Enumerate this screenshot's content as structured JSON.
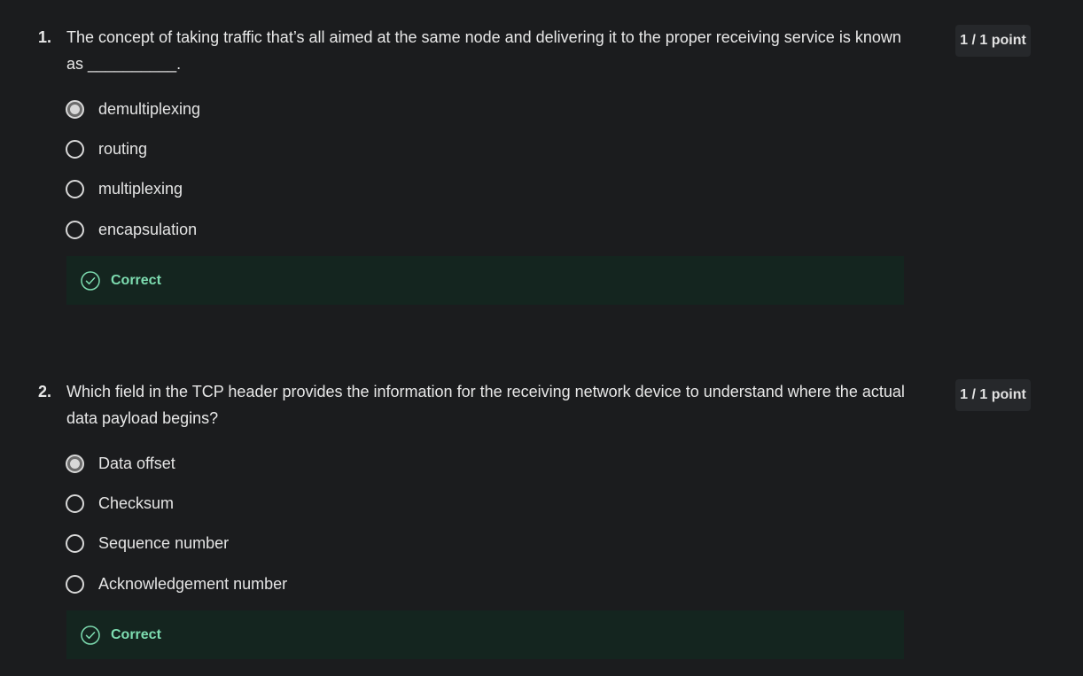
{
  "questions": [
    {
      "number": "1.",
      "text": "The concept of taking traffic that’s all aimed at the same node and delivering it to the proper receiving service is known as __________.",
      "points": "1 / 1 point",
      "options": [
        {
          "label": "demultiplexing",
          "selected": true
        },
        {
          "label": "routing",
          "selected": false
        },
        {
          "label": "multiplexing",
          "selected": false
        },
        {
          "label": "encapsulation",
          "selected": false
        }
      ],
      "feedback": "Correct"
    },
    {
      "number": "2.",
      "text": "Which field in the TCP header provides the information for the receiving network device to understand where the actual data payload begins?",
      "points": "1 / 1 point",
      "options": [
        {
          "label": "Data offset",
          "selected": true
        },
        {
          "label": "Checksum",
          "selected": false
        },
        {
          "label": "Sequence number",
          "selected": false
        },
        {
          "label": "Acknowledgement number",
          "selected": false
        }
      ],
      "feedback": "Correct"
    }
  ],
  "colors": {
    "background": "#1b1c1e",
    "feedback_bg": "#14251f",
    "correct": "#7ddcb0"
  }
}
